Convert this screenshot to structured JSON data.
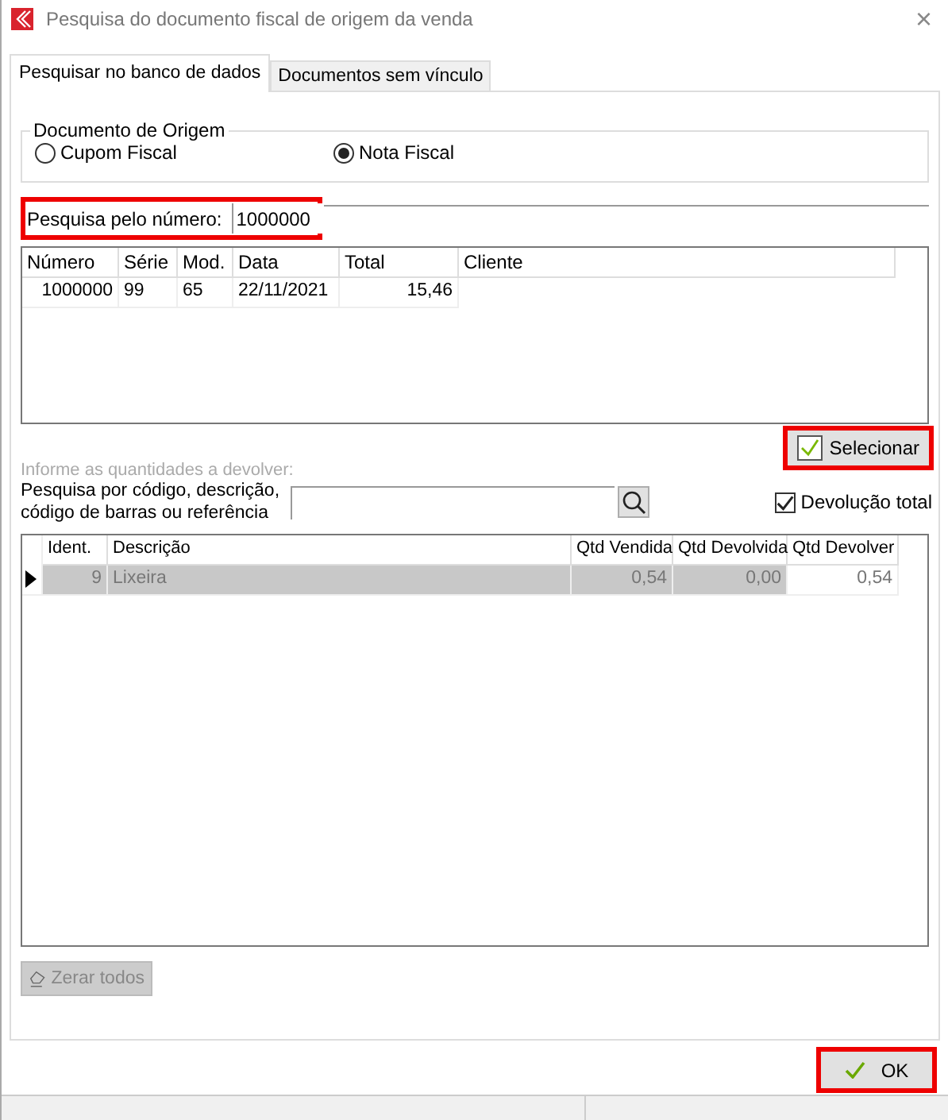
{
  "window": {
    "title": "Pesquisa do documento fiscal de origem da venda",
    "close": "×"
  },
  "tabs": [
    {
      "label": "Pesquisar no banco de dados",
      "selected": true
    },
    {
      "label": "Documentos sem vínculo",
      "selected": false
    }
  ],
  "origin_group": {
    "title": "Documento de Origem",
    "options": [
      {
        "label": "Cupom Fiscal",
        "selected": false
      },
      {
        "label": "Nota Fiscal",
        "selected": true
      }
    ]
  },
  "number_search": {
    "label": "Pesquisa pelo número:",
    "value": "1000000",
    "highlighted": true
  },
  "documents_table": {
    "columns": [
      "Número",
      "Série",
      "Mod.",
      "Data",
      "Total",
      "Cliente"
    ],
    "rows": [
      {
        "cells": [
          "1000000",
          "99",
          "65",
          "22/11/2021",
          "15,46",
          ""
        ]
      }
    ]
  },
  "select_button": {
    "label": "Selecionar",
    "highlighted": true
  },
  "quantities_hint": "Informe as quantidades a devolver:",
  "item_search": {
    "label": "Pesquisa por código, descrição, código de barras ou referência"
  },
  "total_return": {
    "label": "Devolução total",
    "checked": true
  },
  "items_table": {
    "columns": [
      "Ident.",
      "Descrição",
      "Qtd Vendida",
      "Qtd Devolvida",
      "Qtd Devolver"
    ],
    "rows": [
      {
        "selected": true,
        "cells": [
          "9",
          "Lixeira",
          "0,54",
          "0,00",
          "0,54"
        ]
      }
    ]
  },
  "clear_button": {
    "label": "Zerar todos",
    "disabled": true
  },
  "ok_button": {
    "label": "OK",
    "highlighted": true
  }
}
